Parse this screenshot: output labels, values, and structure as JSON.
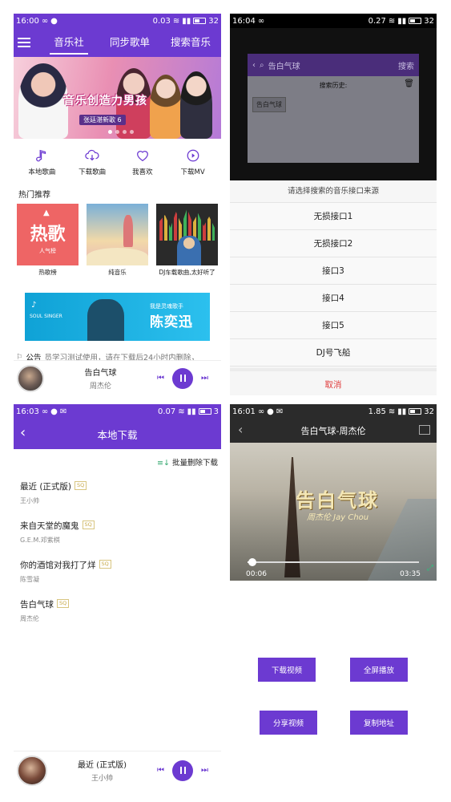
{
  "colors": {
    "accent": "#6c3ad1",
    "cancel": "#e03a3a",
    "batch_icon": "#2ea56b",
    "sq_tag": "#c8aa4a"
  },
  "panel1": {
    "status": {
      "time": "16:00",
      "speed": "0.03",
      "battery": "32"
    },
    "nav": {
      "tabs": [
        "音乐社",
        "同步歌单",
        "搜索音乐"
      ],
      "active": 0
    },
    "banner": {
      "title": "音乐创造力男孩",
      "sub": "张廷湛新歌 6"
    },
    "quick": [
      {
        "label": "本地歌曲",
        "icon": "music-note-icon"
      },
      {
        "label": "下载歌曲",
        "icon": "cloud-download-icon"
      },
      {
        "label": "我喜欢",
        "icon": "heart-icon"
      },
      {
        "label": "下载MV",
        "icon": "play-circle-icon"
      }
    ],
    "section_title": "热门推荐",
    "recs": [
      {
        "label": "热歌榜",
        "cover_big": "热歌",
        "cover_small": "人气榜"
      },
      {
        "label": "纯音乐"
      },
      {
        "label": "DJ车载歌曲,太好听了"
      }
    ],
    "ad": {
      "line1": "我是灵魂歌手",
      "name": "陈奕迅",
      "tag": "SOUL SINGER"
    },
    "notice": {
      "label": "公告",
      "text": "员学习测试使用，请在下载后24小时内删除，"
    },
    "player": {
      "song": "告白气球",
      "artist": "周杰伦"
    }
  },
  "panel2": {
    "status": {
      "time": "16:04",
      "speed": "0.27",
      "battery": "32"
    },
    "search": {
      "query": "告白气球",
      "button": "搜索"
    },
    "history": {
      "title": "搜索历史:",
      "items": [
        "告白气球"
      ]
    },
    "sheet": {
      "title": "请选择搜索的音乐接口来源",
      "options": [
        "无损接口1",
        "无损接口2",
        "接口3",
        "接口4",
        "接口5",
        "DJ号飞船"
      ],
      "cancel": "取消"
    }
  },
  "panel3": {
    "status": {
      "time": "16:03",
      "speed": "0.07",
      "battery": "3"
    },
    "title": "本地下载",
    "batch_delete": "批量删除下载",
    "songs": [
      {
        "name": "最近 (正式版)",
        "tag": "SQ",
        "artist": "王小帅"
      },
      {
        "name": "来自天堂的魔鬼",
        "tag": "SQ",
        "artist": "G.E.M.邓紫棋"
      },
      {
        "name": "你的酒馆对我打了烊",
        "tag": "SQ",
        "artist": "陈雪凝"
      },
      {
        "name": "告白气球",
        "tag": "SQ",
        "artist": "周杰伦"
      }
    ],
    "player": {
      "song": "最近 (正式版)",
      "artist": "王小帅"
    }
  },
  "panel4": {
    "status": {
      "time": "16:01",
      "speed": "1.85",
      "battery": "32"
    },
    "title": "告白气球-周杰伦",
    "video": {
      "overlay_title": "告白气球",
      "overlay_sub": "周杰伦 Jay Chou",
      "current": "00:06",
      "total": "03:35",
      "progress": 0.03
    },
    "actions": [
      "下载视频",
      "全屏播放",
      "分享视频",
      "复制地址"
    ]
  }
}
